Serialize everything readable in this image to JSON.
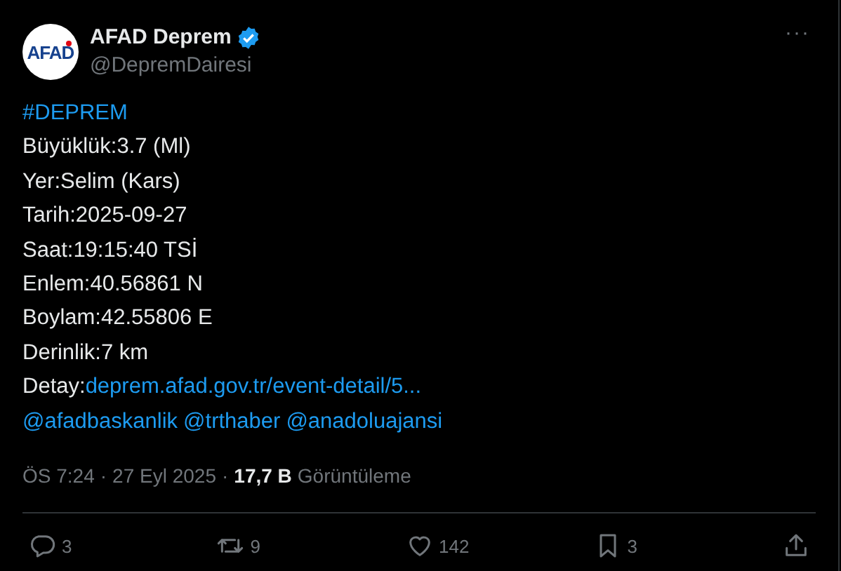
{
  "author": {
    "avatar_text": "AFAD",
    "name": "AFAD Deprem",
    "verified": true,
    "handle": "@DepremDairesi",
    "more": "···"
  },
  "body": [
    {
      "parts": [
        {
          "kind": "link",
          "text": "#DEPREM"
        }
      ]
    },
    {
      "parts": [
        {
          "kind": "plain",
          "text": "Büyüklük:3.7 (Ml)"
        }
      ]
    },
    {
      "parts": [
        {
          "kind": "plain",
          "text": "Yer:Selim (Kars)"
        }
      ]
    },
    {
      "parts": [
        {
          "kind": "plain",
          "text": "Tarih:2025-09-27"
        }
      ]
    },
    {
      "parts": [
        {
          "kind": "plain",
          "text": "Saat:19:15:40 TSİ"
        }
      ]
    },
    {
      "parts": [
        {
          "kind": "plain",
          "text": "Enlem:40.56861 N"
        }
      ]
    },
    {
      "parts": [
        {
          "kind": "plain",
          "text": "Boylam:42.55806 E"
        }
      ]
    },
    {
      "parts": [
        {
          "kind": "plain",
          "text": "Derinlik:7 km"
        }
      ]
    },
    {
      "parts": [
        {
          "kind": "plain",
          "text": "Detay:"
        },
        {
          "kind": "link",
          "text": "deprem.afad.gov.tr/event-detail/5..."
        }
      ]
    },
    {
      "parts": [
        {
          "kind": "link",
          "text": "@afadbaskanlik"
        },
        {
          "kind": "link",
          "text": "@trthaber"
        },
        {
          "kind": "link",
          "text": "@anadoluajansi"
        }
      ]
    }
  ],
  "meta": {
    "time": "ÖS 7:24",
    "separator": "·",
    "date": "27 Eyl 2025",
    "separator_2": "·",
    "views": "17,7 B",
    "views_label": "Görüntüleme"
  },
  "actions": [
    {
      "kind": "reply",
      "count": "3"
    },
    {
      "kind": "repost",
      "count": "9"
    },
    {
      "kind": "like",
      "count": "142"
    },
    {
      "kind": "bookmark",
      "count": "3"
    },
    {
      "kind": "share"
    }
  ]
}
